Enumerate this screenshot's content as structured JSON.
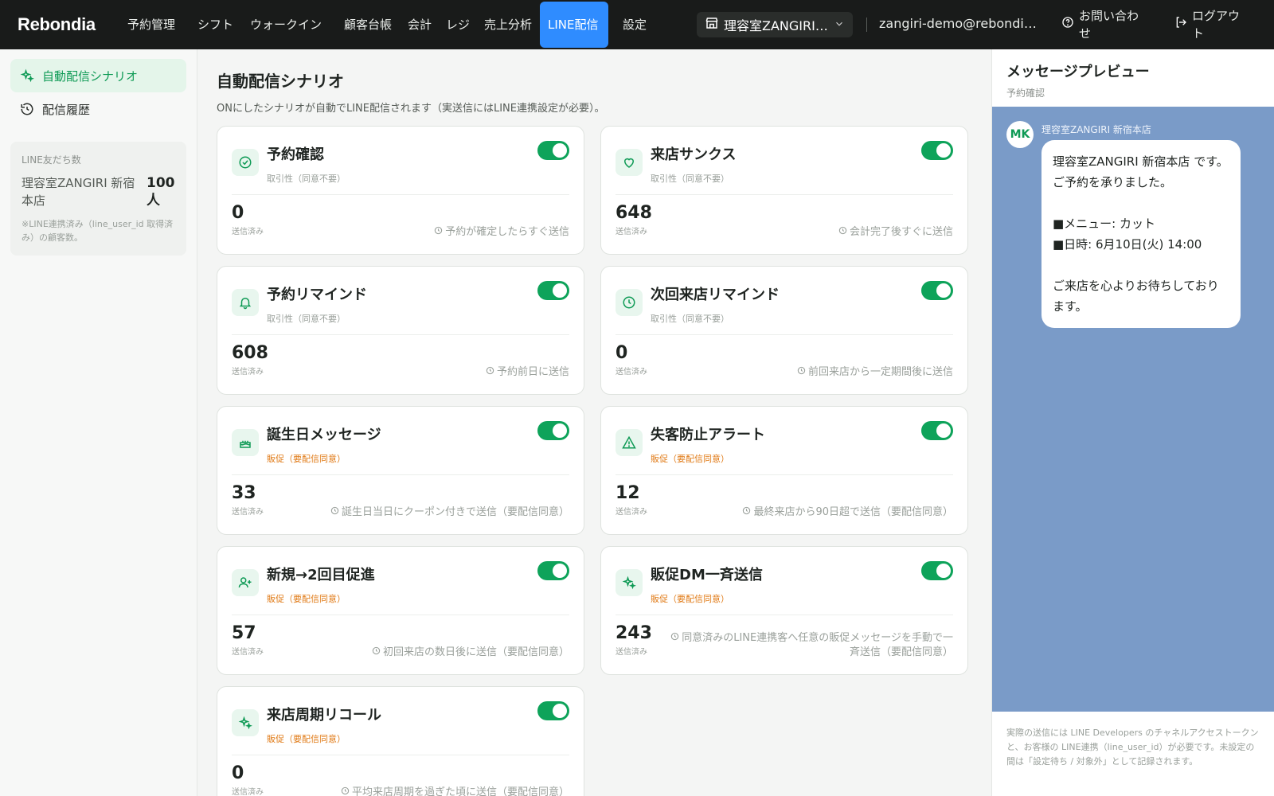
{
  "app": {
    "brand": "Rebondia"
  },
  "nav": {
    "items": [
      {
        "label": "予約管理",
        "active": false
      },
      {
        "label": "シフト",
        "active": false
      },
      {
        "label": "ウォークイン",
        "active": false
      },
      {
        "label": "顧客台帳",
        "active": false
      },
      {
        "label": "会計",
        "active": false
      },
      {
        "label": "レジ",
        "active": false
      },
      {
        "label": "売上分析",
        "active": false
      },
      {
        "label": "LINE配信",
        "active": true
      },
      {
        "label": "設定",
        "active": false
      }
    ],
    "store_select": "理容室ZANGIRI…",
    "email": "zangiri-demo@rebondia.…",
    "contact": "お問い合わせ",
    "logout": "ログアウト"
  },
  "sidebar": {
    "items": [
      {
        "label": "自動配信シナリオ",
        "icon": "sparkle-icon",
        "active": true
      },
      {
        "label": "配信履歴",
        "icon": "history-icon",
        "active": false
      }
    ],
    "friends": {
      "label": "LINE友だち数",
      "store": "理容室ZANGIRI 新宿本店",
      "count": "100人",
      "note": "※LINE連携済み（line_user_id 取得済み）の顧客数。"
    }
  },
  "main": {
    "title": "自動配信シナリオ",
    "subtitle": "ONにしたシナリオが自動でLINE配信されます（実送信にはLINE連携設定が必要）。",
    "sent_label": "送信済み",
    "cards": [
      {
        "title": "予約確認",
        "tag": "取引性（同意不要）",
        "promo": false,
        "icon": "check-circle-icon",
        "count": "0",
        "desc": "予約が確定したらすぐ送信",
        "enabled": true
      },
      {
        "title": "来店サンクス",
        "tag": "取引性（同意不要）",
        "promo": false,
        "icon": "heart-icon",
        "count": "648",
        "desc": "会計完了後すぐに送信",
        "enabled": true
      },
      {
        "title": "予約リマインド",
        "tag": "取引性（同意不要）",
        "promo": false,
        "icon": "bell-icon",
        "count": "608",
        "desc": "予約前日に送信",
        "enabled": true
      },
      {
        "title": "次回来店リマインド",
        "tag": "取引性（同意不要）",
        "promo": false,
        "icon": "clock-icon",
        "count": "0",
        "desc": "前回来店から一定期間後に送信",
        "enabled": true
      },
      {
        "title": "誕生日メッセージ",
        "tag": "販促（要配信同意）",
        "promo": true,
        "icon": "cake-icon",
        "count": "33",
        "desc": "誕生日当日にクーポン付きで送信（要配信同意）",
        "enabled": true
      },
      {
        "title": "失客防止アラート",
        "tag": "販促（要配信同意）",
        "promo": true,
        "icon": "alert-icon",
        "count": "12",
        "desc": "最終来店から90日超で送信（要配信同意）",
        "enabled": true
      },
      {
        "title": "新規→2回目促進",
        "tag": "販促（要配信同意）",
        "promo": true,
        "icon": "user-plus-icon",
        "count": "57",
        "desc": "初回来店の数日後に送信（要配信同意）",
        "enabled": true
      },
      {
        "title": "販促DM一斉送信",
        "tag": "販促（要配信同意）",
        "promo": true,
        "icon": "sparkle-icon",
        "count": "243",
        "desc": "同意済みのLINE連携客へ任意の販促メッセージを手動で一斉送信（要配信同意）",
        "enabled": true
      },
      {
        "title": "来店周期リコール",
        "tag": "販促（要配信同意）",
        "promo": true,
        "icon": "sparkle-icon",
        "count": "0",
        "desc": "平均来店周期を過ぎた頃に送信（要配信同意）",
        "enabled": true
      }
    ]
  },
  "preview": {
    "title": "メッセージプレビュー",
    "subtitle": "予約確認",
    "avatar": "MK",
    "sender": "理容室ZANGIRI 新宿本店",
    "lines": [
      "理容室ZANGIRI 新宿本店 です。",
      "ご予約を承りました。",
      "",
      "■メニュー: カット",
      "■日時: 6月10日(火) 14:00",
      "",
      "ご来店を心よりお待ちしております。"
    ],
    "footer": "実際の送信には LINE Developers のチャネルアクセストークンと、お客様の LINE連携（line_user_id）が必要です。未設定の間は「設定待ち / 対象外」として記録されます。"
  },
  "colors": {
    "accent": "#0ea35a",
    "nav_active": "#2f8cff",
    "promo": "#e07a16",
    "chat_bg": "#7a9bc8"
  }
}
